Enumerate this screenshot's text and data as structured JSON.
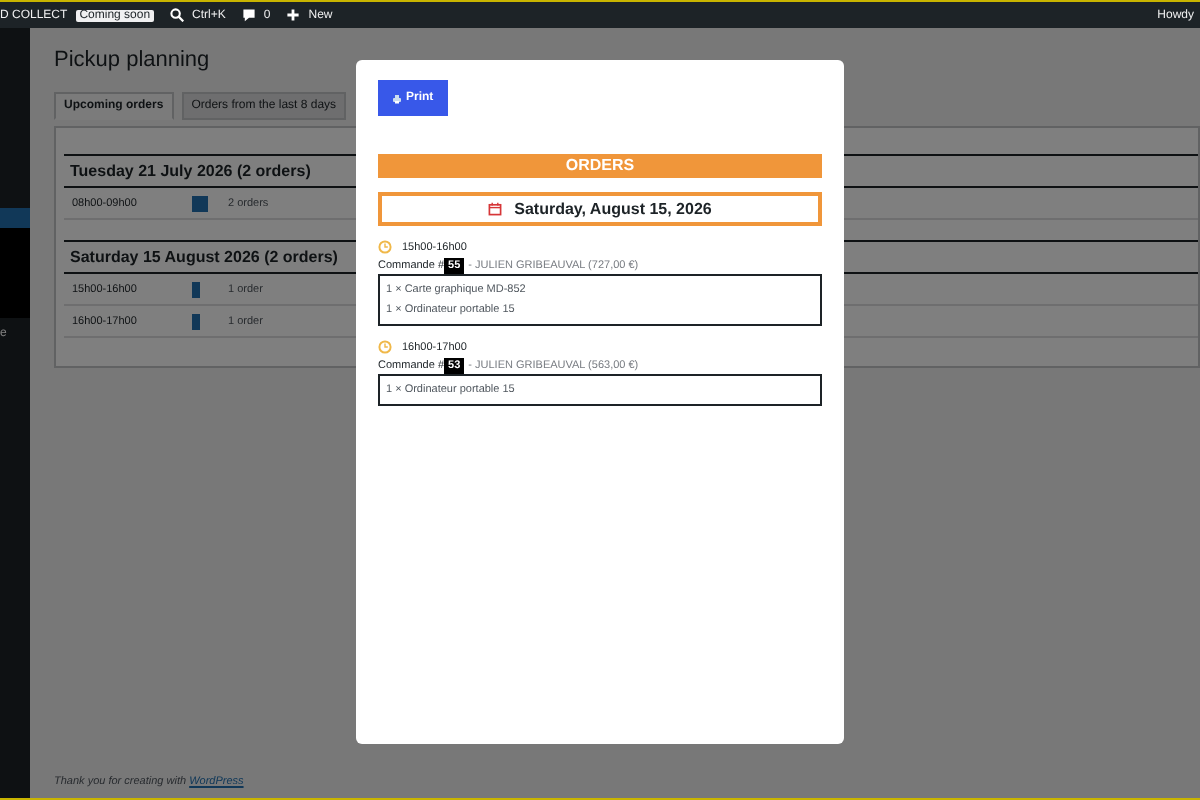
{
  "admin_bar": {
    "site_name": "D COLLECT",
    "badge": "Coming soon",
    "search_shortcut": "Ctrl+K",
    "comments": "0",
    "new_label": "New",
    "greeting": "Howdy"
  },
  "sidebar": {
    "items": [
      {
        "selected": true
      },
      {
        "label": "e",
        "selected": false
      }
    ]
  },
  "page": {
    "title": "Pickup planning",
    "tabs": [
      {
        "label": "Upcoming orders",
        "selected": true
      },
      {
        "label": "Orders from the last 8 days",
        "selected": false
      }
    ],
    "days": [
      {
        "heading": "Tuesday 21 July 2026 (2 orders)",
        "slots": [
          {
            "time": "08h00-09h00",
            "kind": "wide",
            "count": "2 orders"
          }
        ]
      },
      {
        "heading": "Saturday 15 August 2026 (2 orders)",
        "slots": [
          {
            "time": "15h00-16h00",
            "kind": "narrow",
            "count": "1 order"
          },
          {
            "time": "16h00-17h00",
            "kind": "narrow",
            "count": "1 order"
          }
        ]
      }
    ],
    "footer": {
      "text": "Thank you for creating with",
      "link": "WordPress"
    }
  },
  "modal": {
    "print_label": "Print",
    "header": "ORDERS",
    "date": "Saturday, August 15, 2026",
    "groups": [
      {
        "time": "15h00-16h00",
        "prefix": "Commande #",
        "number": "55",
        "customer": "- JULIEN GRIBEAUVAL (727,00 €)",
        "lines": [
          "1 × Carte graphique MD-852",
          "1 × Ordinateur portable 15"
        ]
      },
      {
        "time": "16h00-17h00",
        "prefix": "Commande #",
        "number": "53",
        "customer": "- JULIEN GRIBEAUVAL (563,00 €)",
        "lines": [
          "1 × Ordinateur portable 15"
        ]
      }
    ]
  }
}
